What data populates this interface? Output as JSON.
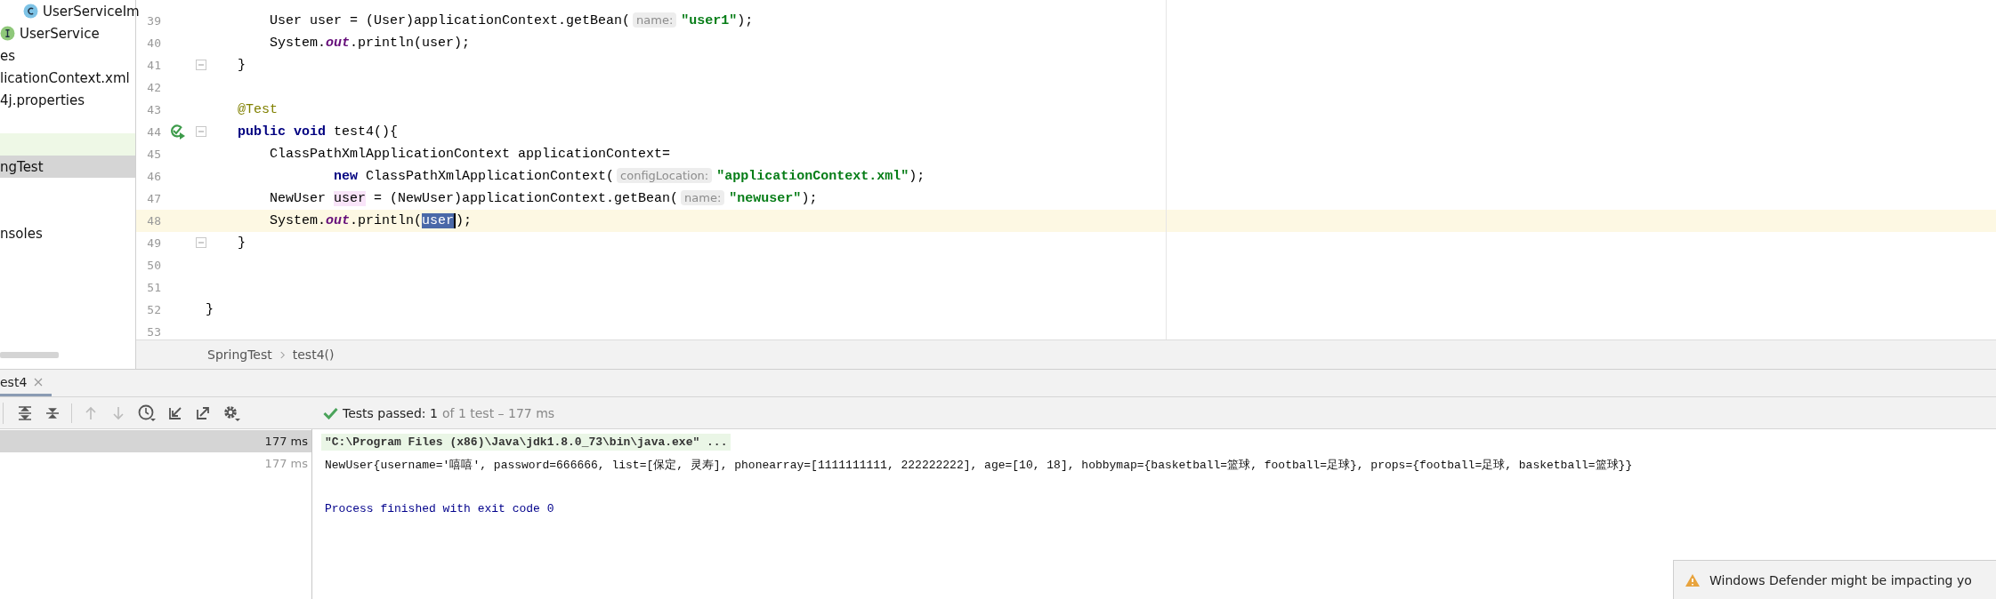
{
  "project_tree": {
    "items": [
      {
        "kind": "class",
        "label": "UserServiceIm",
        "selected": false,
        "highlighted": false
      },
      {
        "kind": "interface",
        "label": "UserService",
        "selected": false,
        "highlighted": false
      },
      {
        "kind": "file",
        "label": "es",
        "selected": false,
        "highlighted": false
      },
      {
        "kind": "file",
        "label": "licationContext.xml",
        "selected": false,
        "highlighted": false
      },
      {
        "kind": "file",
        "label": "4j.properties",
        "selected": false,
        "highlighted": false
      },
      {
        "kind": "empty"
      },
      {
        "kind": "empty",
        "highlighted": true
      },
      {
        "kind": "file",
        "label": "ngTest",
        "selected": true,
        "highlighted": false
      },
      {
        "kind": "empty"
      },
      {
        "kind": "empty"
      },
      {
        "kind": "file",
        "label": "nsoles",
        "selected": false,
        "highlighted": false
      }
    ]
  },
  "editor": {
    "lines": [
      {
        "number": "39",
        "tokens": [
          {
            "kind": "plain",
            "text": "        User user = (User)applicationContext.getBean("
          },
          {
            "kind": "hint",
            "text": "name:"
          },
          {
            "kind": "string",
            "text": "\"user1\""
          },
          {
            "kind": "plain",
            "text": ");"
          }
        ]
      },
      {
        "number": "40",
        "tokens": [
          {
            "kind": "plain",
            "text": "        System."
          },
          {
            "kind": "static",
            "text": "out"
          },
          {
            "kind": "plain",
            "text": ".println(user);"
          }
        ]
      },
      {
        "number": "41",
        "fold": true,
        "tokens": [
          {
            "kind": "plain",
            "text": "    }"
          }
        ]
      },
      {
        "number": "42"
      },
      {
        "number": "43",
        "tokens": [
          {
            "kind": "annotation",
            "text": "    @Test"
          }
        ]
      },
      {
        "number": "44",
        "fold": true,
        "run_icon": true,
        "tokens": [
          {
            "kind": "keyword",
            "text": "    public void"
          },
          {
            "kind": "plain",
            "text": " test4(){"
          }
        ]
      },
      {
        "number": "45",
        "tokens": [
          {
            "kind": "plain",
            "text": "        ClassPathXmlApplicationContext applicationContext="
          }
        ]
      },
      {
        "number": "46",
        "tokens": [
          {
            "kind": "keyword",
            "text": "                new"
          },
          {
            "kind": "plain",
            "text": " ClassPathXmlApplicationContext("
          },
          {
            "kind": "hint",
            "text": "configLocation:"
          },
          {
            "kind": "string",
            "text": "\"applicationContext.xml\""
          },
          {
            "kind": "plain",
            "text": ");"
          }
        ]
      },
      {
        "number": "47",
        "tokens": [
          {
            "kind": "plain",
            "text": "        NewUser "
          },
          {
            "kind": "usage",
            "text": "user"
          },
          {
            "kind": "plain",
            "text": " = (NewUser)applicationContext.getBean("
          },
          {
            "kind": "hint",
            "text": "name:"
          },
          {
            "kind": "string",
            "text": "\"newuser\""
          },
          {
            "kind": "plain",
            "text": ");"
          }
        ]
      },
      {
        "number": "48",
        "current": true,
        "tokens": [
          {
            "kind": "plain",
            "text": "        System."
          },
          {
            "kind": "static",
            "text": "out"
          },
          {
            "kind": "plain",
            "text": ".println("
          },
          {
            "kind": "selection",
            "text": "user"
          },
          {
            "kind": "plain",
            "text": ");"
          }
        ]
      },
      {
        "number": "49",
        "fold": true,
        "tokens": [
          {
            "kind": "plain",
            "text": "    }"
          }
        ]
      },
      {
        "number": "50"
      },
      {
        "number": "51"
      },
      {
        "number": "52",
        "tokens": [
          {
            "kind": "plain",
            "text": "}"
          }
        ]
      },
      {
        "number": "53"
      }
    ]
  },
  "breadcrumbs": [
    "SpringTest",
    "test4()"
  ],
  "run_panel": {
    "tabs": [
      {
        "label": "est4",
        "selected": true
      }
    ],
    "status": {
      "passed": "Tests passed: 1",
      "detail": "of 1 test – 177 ms"
    },
    "test_rows": [
      {
        "duration": "177 ms",
        "selected": true
      },
      {
        "duration": "177 ms",
        "selected": false
      }
    ],
    "console": [
      {
        "kind": "command",
        "text": "\"C:\\Program Files (x86)\\Java\\jdk1.8.0_73\\bin\\java.exe\" ..."
      },
      {
        "kind": "output",
        "text": "NewUser{username='嘻嘻', password=666666, list=[保定, 灵寿], phonearray=[1111111111, 222222222], age=[10, 18], hobbymap={basketball=篮球, football=足球}, props={football=足球, basketball=篮球}}"
      },
      {
        "kind": "blank"
      },
      {
        "kind": "exit",
        "text": "Process finished with exit code 0"
      }
    ]
  },
  "notification": {
    "text": "Windows Defender might be impacting yo"
  }
}
